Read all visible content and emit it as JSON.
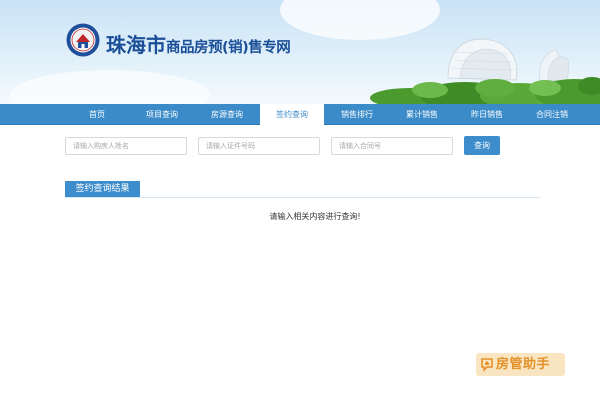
{
  "header": {
    "title_big": "珠海市",
    "title_small": "商品房预(销)售专网"
  },
  "nav": {
    "items": [
      {
        "label": "首页"
      },
      {
        "label": "项目查询"
      },
      {
        "label": "房源查询"
      },
      {
        "label": "签约查询",
        "active": true
      },
      {
        "label": "销售排行"
      },
      {
        "label": "累计销售"
      },
      {
        "label": "昨日销售"
      },
      {
        "label": "合同注销"
      }
    ]
  },
  "search": {
    "buyer_placeholder": "请输入购房人姓名",
    "id_placeholder": "请输入证件号码",
    "contract_placeholder": "请输入合同号",
    "button_label": "查询"
  },
  "result": {
    "title": "签约查询结果",
    "message": "请输入相关内容进行查询!"
  },
  "watermark": {
    "text": "房管助手"
  },
  "colors": {
    "nav_bg": "#3b8bc9",
    "title_blue": "#1a4f98",
    "button_blue": "#3d8ccb",
    "watermark_orange": "#e3922b"
  }
}
